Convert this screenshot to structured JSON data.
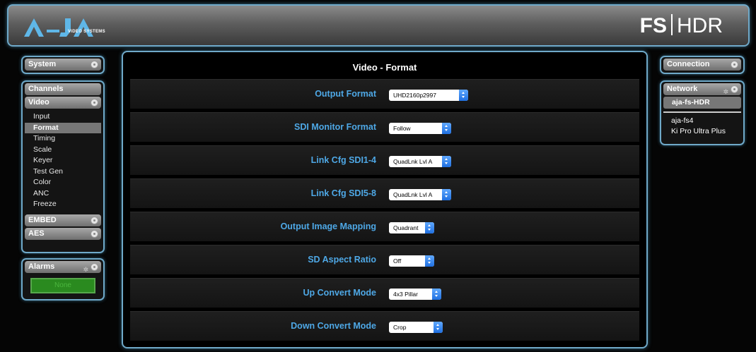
{
  "header": {
    "logo_text": "VIDEO SYSTEMS",
    "product_bold": "FS",
    "product_thin": "HDR",
    "logo_alt": "AJA"
  },
  "left_nav": {
    "system": "System",
    "channels": "Channels",
    "video": "Video",
    "video_items": [
      "Input",
      "Format",
      "Timing",
      "Scale",
      "Keyer",
      "Test Gen",
      "Color",
      "ANC",
      "Freeze"
    ],
    "active_item": "Format",
    "embed": "EMBED",
    "aes": "AES",
    "alarms": "Alarms",
    "alarm_status": "None"
  },
  "right_nav": {
    "connection": "Connection",
    "network": "Network",
    "active_device": "aja-fs-HDR",
    "devices": [
      "aja-fs4",
      "Ki Pro Ultra Plus"
    ]
  },
  "main": {
    "title": "Video - Format",
    "rows": [
      {
        "label": "Output Format",
        "value": "UHD2160p2997"
      },
      {
        "label": "SDI Monitor Format",
        "value": "Follow"
      },
      {
        "label": "Link Cfg SDI1-4",
        "value": "QuadLnk Lvl A"
      },
      {
        "label": "Link Cfg SDI5-8",
        "value": "QuadLnk Lvl A"
      },
      {
        "label": "Output Image Mapping",
        "value": "Quadrant"
      },
      {
        "label": "SD Aspect Ratio",
        "value": "Off"
      },
      {
        "label": "Up Convert Mode",
        "value": "4x3 Pillar"
      },
      {
        "label": "Down Convert Mode",
        "value": "Crop"
      }
    ]
  },
  "colors": {
    "accent_border": "#6fa9c9",
    "label_blue": "#4ea8e6",
    "alarm_green": "#2a8a1f"
  }
}
